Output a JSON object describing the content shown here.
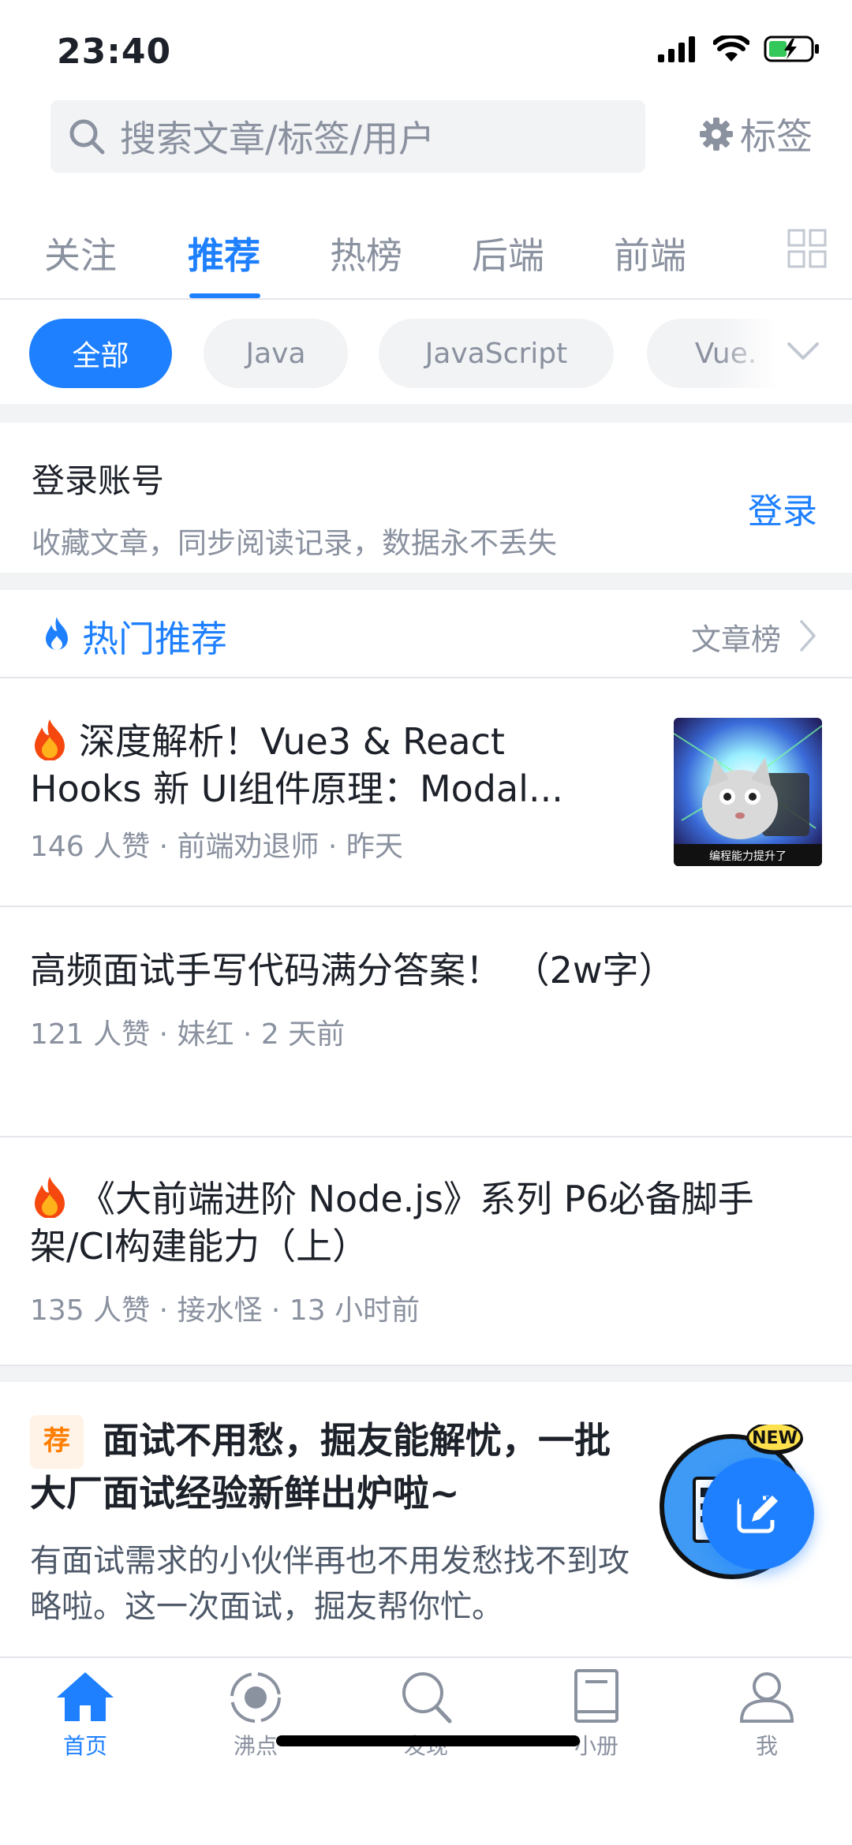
{
  "status_bar": {
    "time": "23:40"
  },
  "search": {
    "placeholder": "搜索文章/标签/用户",
    "tag_label": "标签"
  },
  "channel_tabs": [
    {
      "label": "关注",
      "active": false
    },
    {
      "label": "推荐",
      "active": true
    },
    {
      "label": "热榜",
      "active": false
    },
    {
      "label": "后端",
      "active": false
    },
    {
      "label": "前端",
      "active": false
    }
  ],
  "chips": [
    {
      "label": "全部",
      "active": true
    },
    {
      "label": "Java",
      "active": false
    },
    {
      "label": "JavaScript",
      "active": false
    },
    {
      "label": "Vue.",
      "active": false
    }
  ],
  "login_card": {
    "title": "登录账号",
    "subtitle": "收藏文章，同步阅读记录，数据永不丢失",
    "button": "登录"
  },
  "hot": {
    "title": "热门推荐",
    "rank_link": "文章榜"
  },
  "articles": [
    {
      "title_line1": "深度解析！Vue3 & React",
      "title_line2": "Hooks 新 UI组件原理：Modal...",
      "meta": "146 人赞 · 前端劝退师 · 昨天",
      "thumb_caption": "编程能力提升了"
    },
    {
      "title_line1": "高频面试手写代码满分答案！ （2w字）",
      "meta": "121 人赞 · 妹红 · 2 天前"
    },
    {
      "title_line1": "《大前端进阶 Node.js》系列 P6必备脚手",
      "title_line2": "架/CI构建能力（上）",
      "meta": "135 人赞 · 接水怪 · 13 小时前"
    }
  ],
  "promo": {
    "badge": "荐",
    "title": "面试不用愁，掘友能解忧，一批大厂面试经验新鲜出炉啦~",
    "description": "有面试需求的小伙伴再也不用发愁找不到攻略啦。这一次面试，掘友帮你忙。",
    "new_badge": "NEW"
  },
  "bottom_nav": [
    {
      "label": "首页",
      "icon": "home-icon",
      "active": true
    },
    {
      "label": "沸点",
      "icon": "pin-icon",
      "active": false
    },
    {
      "label": "发现",
      "icon": "search-icon",
      "active": false
    },
    {
      "label": "小册",
      "icon": "book-icon",
      "active": false
    },
    {
      "label": "我",
      "icon": "user-icon",
      "active": false
    }
  ],
  "colors": {
    "accent": "#1e80ff",
    "muted": "#8a919f",
    "text": "#1d2129",
    "divider": "#e5e6eb",
    "promo_badge": "#ff7d00"
  }
}
